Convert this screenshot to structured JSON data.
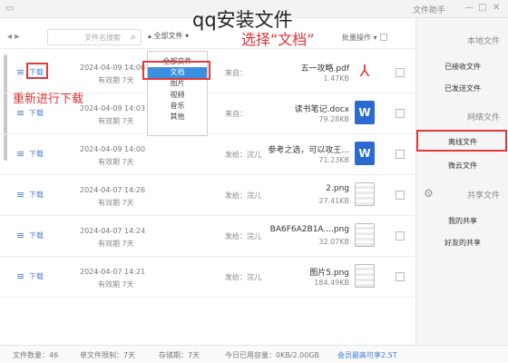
{
  "page_title": "qq安装文件",
  "window": {
    "title": "文件助手",
    "min_btn": "—",
    "max_btn": "□",
    "close_btn": "✕"
  },
  "toolbar": {
    "search_placeholder": "文件名搜索",
    "filter_label": "全部文件",
    "batch_label": "批量操作"
  },
  "dropdown": {
    "options": [
      "全部文件",
      "文档",
      "图片",
      "视频",
      "音乐",
      "其他"
    ],
    "selected_index": 1
  },
  "annotations": {
    "select": "选择“文档”",
    "redownload": "重新进行下载"
  },
  "files": [
    {
      "name": "五一攻略.pdf",
      "size": "1.47KB",
      "date": "2024-04-09 14:06",
      "expiry": "有效期 7天",
      "from": "来自：",
      "type": "pdf",
      "download": "下载",
      "highlighted": true
    },
    {
      "name": "读书笔记.docx",
      "size": "79.28KB",
      "date": "2024-04-09 14:03",
      "expiry": "有效期 7天",
      "from": "来自：",
      "type": "doc",
      "download": "下载",
      "highlighted": false
    },
    {
      "name": "参考之选，可以攻王...",
      "size": "71.23KB",
      "date": "2024-04-09 14:00",
      "expiry": "有效期 7天",
      "from": "发给：浣儿",
      "type": "doc",
      "download": "下载",
      "highlighted": false
    },
    {
      "name": "2.png",
      "size": "27.41KB",
      "date": "2024-04-07 14:26",
      "expiry": "有效期 7天",
      "from": "发给：浣儿",
      "type": "png",
      "download": "下载",
      "highlighted": false
    },
    {
      "name": "BA6F6A2B1A....png",
      "size": "32.07KB",
      "date": "2024-04-07 14:24",
      "expiry": "有效期 7天",
      "from": "发给：浣儿",
      "type": "png",
      "download": "下载",
      "highlighted": false
    },
    {
      "name": "图片5.png",
      "size": "184.49KB",
      "date": "2024-04-07 14:21",
      "expiry": "有效期 7天",
      "from": "发给：浣儿",
      "type": "png",
      "download": "下载",
      "highlighted": false
    }
  ],
  "sidebar": {
    "sections": [
      {
        "title": "本地文件",
        "items": [
          "已接收文件",
          "已发送文件"
        ]
      },
      {
        "title": "网络文件",
        "items": [
          "离线文件",
          "微云文件"
        ]
      },
      {
        "title": "共享文件",
        "items": [
          "我的共享",
          "好友的共享"
        ]
      }
    ],
    "active_item": "离线文件"
  },
  "status": {
    "count": "文件数量：46",
    "type": "单文件限制：7天",
    "expiry": "存储期：7天",
    "used": "今日已用容量：0KB/2.00GB",
    "upgrade": "会员最高可享2.5T"
  }
}
